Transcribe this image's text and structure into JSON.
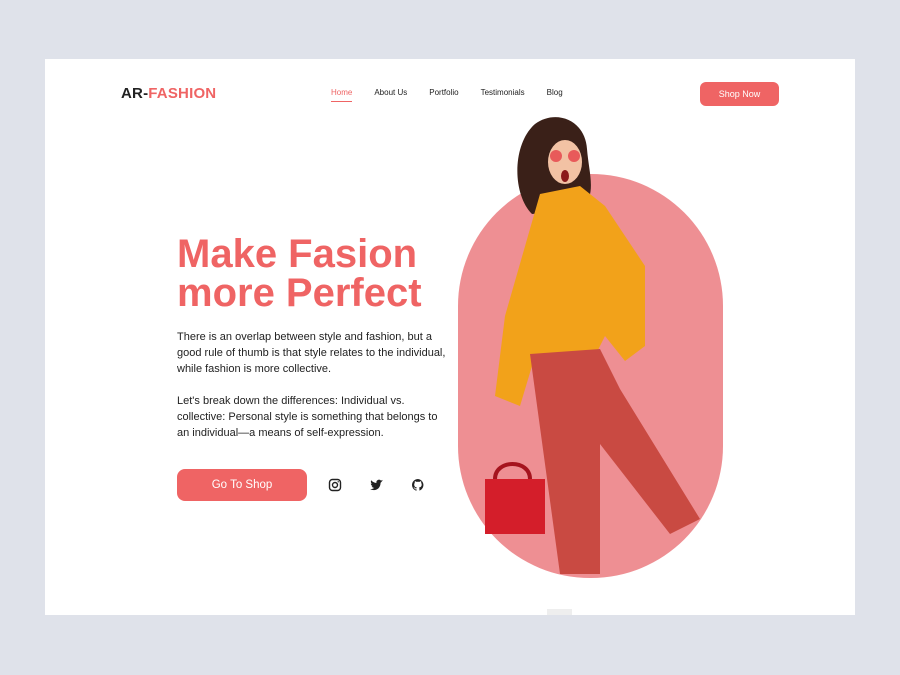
{
  "brand": {
    "prefix": "AR-",
    "accent": "FASHION"
  },
  "nav": [
    {
      "label": "Home",
      "active": true
    },
    {
      "label": "About Us"
    },
    {
      "label": "Portfolio"
    },
    {
      "label": "Testimonials"
    },
    {
      "label": "Blog"
    }
  ],
  "header": {
    "cta": "Shop Now"
  },
  "hero": {
    "title": "Make Fasion more Perfect",
    "para1": "There is an overlap between style and fashion, but a good rule of thumb is that style relates to the individual, while fashion is more collective.",
    "para2": "Let's break down the differences: Individual vs. collective: Personal style is something that belongs to an individual—a means of self-expression.",
    "cta": "Go To Shop"
  },
  "social": [
    "instagram-icon",
    "twitter-icon",
    "github-icon"
  ],
  "colors": {
    "accent": "#ef6464",
    "background": "#dfe2ea",
    "pill": "#ee8f93"
  }
}
